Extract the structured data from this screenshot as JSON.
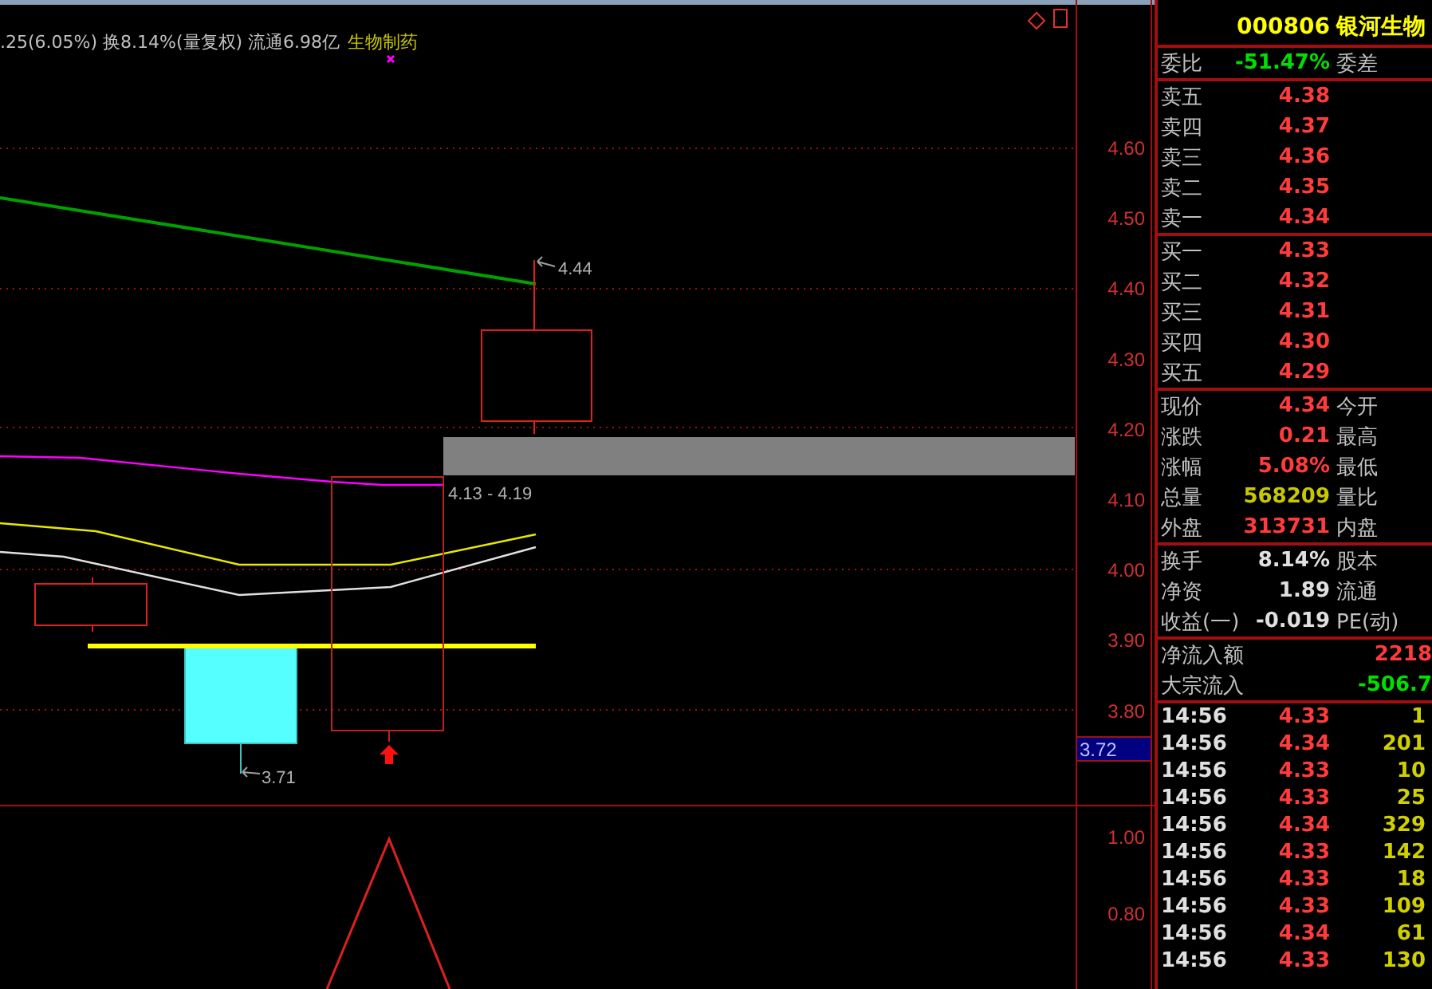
{
  "header": {
    "info": ".25(6.05%) 换8.14%(量复权) 流通6.98亿",
    "sector": "生物制药"
  },
  "chart": {
    "price_axis": [
      "4.60",
      "4.50",
      "4.40",
      "4.30",
      "4.20",
      "4.10",
      "4.00",
      "3.90",
      "3.80"
    ],
    "price_tag": "3.72",
    "high_label": "4.44",
    "zone_label": "4.13 - 4.19",
    "low_label": "3.71",
    "indicator_axis": [
      "1.00",
      "0.80"
    ]
  },
  "panel": {
    "code": "000806",
    "name": "银河生物",
    "ratio": {
      "label": "委比",
      "value": "-51.47%",
      "label2": "委差"
    },
    "asks": [
      {
        "label": "卖五",
        "price": "4.38"
      },
      {
        "label": "卖四",
        "price": "4.37"
      },
      {
        "label": "卖三",
        "price": "4.36"
      },
      {
        "label": "卖二",
        "price": "4.35"
      },
      {
        "label": "卖一",
        "price": "4.34"
      }
    ],
    "bids": [
      {
        "label": "买一",
        "price": "4.33"
      },
      {
        "label": "买二",
        "price": "4.32"
      },
      {
        "label": "买三",
        "price": "4.31"
      },
      {
        "label": "买四",
        "price": "4.30"
      },
      {
        "label": "买五",
        "price": "4.29"
      }
    ],
    "quotes": [
      {
        "label": "现价",
        "value": "4.34",
        "label2": "今开",
        "color": "#ff3b3b"
      },
      {
        "label": "涨跌",
        "value": "0.21",
        "label2": "最高",
        "color": "#ff3b3b"
      },
      {
        "label": "涨幅",
        "value": "5.08%",
        "label2": "最低",
        "color": "#ff3b3b"
      },
      {
        "label": "总量",
        "value": "568209",
        "label2": "量比",
        "color": "#c8c800"
      },
      {
        "label": "外盘",
        "value": "313731",
        "label2": "内盘",
        "color": "#ff3b3b"
      }
    ],
    "stats": [
      {
        "label": "换手",
        "value": "8.14%",
        "label2": "股本"
      },
      {
        "label": "净资",
        "value": "1.89",
        "label2": "流通"
      },
      {
        "label": "收益(一)",
        "value": "-0.019",
        "label2": "PE(动)"
      }
    ],
    "flows": [
      {
        "label": "净流入额",
        "value": "2218",
        "color": "#ff3b3b"
      },
      {
        "label": "大宗流入",
        "value": "-506.7",
        "color": "#00e000"
      }
    ],
    "ticks": [
      {
        "time": "14:56",
        "price": "4.33",
        "volume": "1"
      },
      {
        "time": "14:56",
        "price": "4.34",
        "volume": "201"
      },
      {
        "time": "14:56",
        "price": "4.33",
        "volume": "10"
      },
      {
        "time": "14:56",
        "price": "4.33",
        "volume": "25"
      },
      {
        "time": "14:56",
        "price": "4.34",
        "volume": "329"
      },
      {
        "time": "14:56",
        "price": "4.33",
        "volume": "142"
      },
      {
        "time": "14:56",
        "price": "4.33",
        "volume": "18"
      },
      {
        "time": "14:56",
        "price": "4.33",
        "volume": "109"
      },
      {
        "time": "14:56",
        "price": "4.34",
        "volume": "61"
      },
      {
        "time": "14:56",
        "price": "4.33",
        "volume": "130"
      }
    ]
  }
}
